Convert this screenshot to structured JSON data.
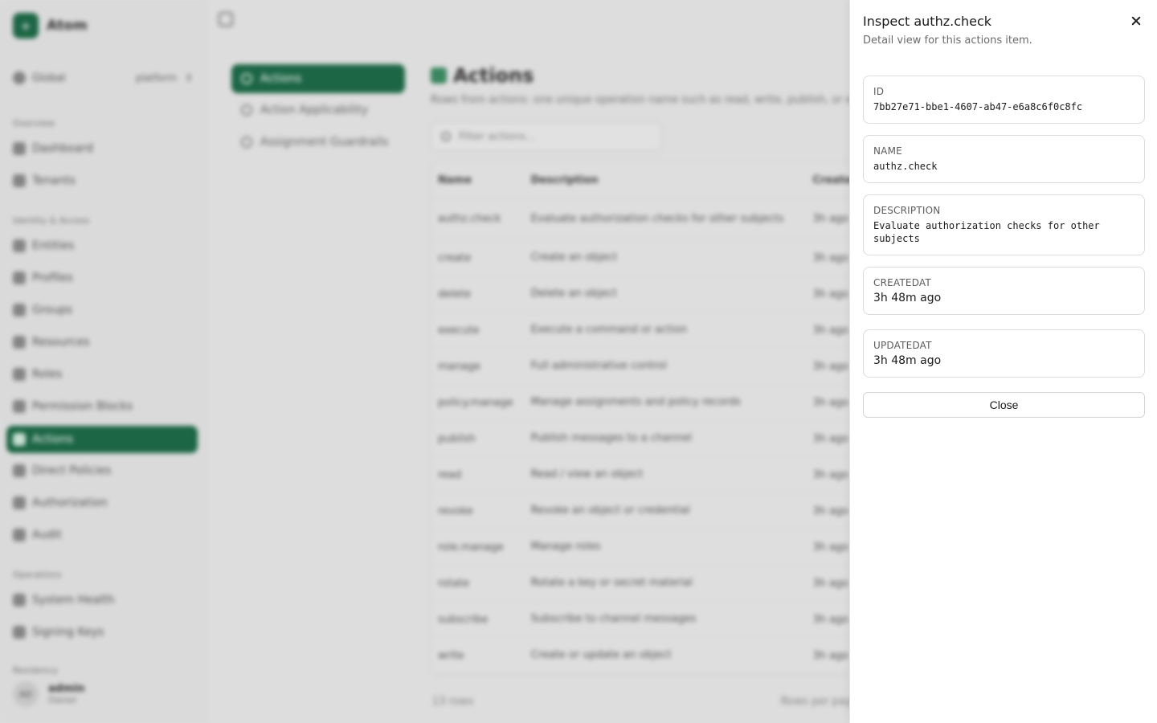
{
  "background": {
    "brand": {
      "logo": "+",
      "name": "Atom"
    },
    "scope": {
      "label": "Global",
      "tag": "platform"
    },
    "sections": {
      "overview": "Overview",
      "identity": "Identity & Access",
      "operations": "Operations",
      "residency": "Residency"
    },
    "nav": {
      "dashboard": "Dashboard",
      "tenants": "Tenants",
      "entities": "Entities",
      "profiles": "Profiles",
      "groups": "Groups",
      "resources": "Resources",
      "roles": "Roles",
      "permission_blocks": "Permission Blocks",
      "actions": "Actions",
      "direct_policies": "Direct Policies",
      "authorization": "Authorization",
      "audit": "Audit",
      "system_health": "System Health",
      "signing_keys": "Signing Keys"
    },
    "user": {
      "initials": "AD",
      "name": "admin",
      "role": "Owner"
    },
    "sub_nav": {
      "actions": "Actions",
      "applicability": "Action Applicability",
      "guardrails": "Assignment Guardrails"
    },
    "page": {
      "title": "Actions",
      "subtitle": "Rows from actions: one unique operation name such as read, write, publish, or execute",
      "filter_placeholder": "Filter actions..."
    },
    "table": {
      "headers": {
        "name": "Name",
        "description": "Description",
        "created": "Created"
      },
      "rows": [
        {
          "name": "authz.check",
          "description": "Evaluate authorization checks for other subjects",
          "created": "3h ago"
        },
        {
          "name": "create",
          "description": "Create an object",
          "created": "3h ago"
        },
        {
          "name": "delete",
          "description": "Delete an object",
          "created": "3h ago"
        },
        {
          "name": "execute",
          "description": "Execute a command or action",
          "created": "3h ago"
        },
        {
          "name": "manage",
          "description": "Full administrative control",
          "created": "3h ago"
        },
        {
          "name": "policy.manage",
          "description": "Manage assignments and policy records",
          "created": "3h ago"
        },
        {
          "name": "publish",
          "description": "Publish messages to a channel",
          "created": "3h ago"
        },
        {
          "name": "read",
          "description": "Read / view an object",
          "created": "3h ago"
        },
        {
          "name": "revoke",
          "description": "Revoke an object or credential",
          "created": "3h ago"
        },
        {
          "name": "role.manage",
          "description": "Manage roles",
          "created": "3h ago"
        },
        {
          "name": "rotate",
          "description": "Rotate a key or secret material",
          "created": "3h ago"
        },
        {
          "name": "subscribe",
          "description": "Subscribe to channel messages",
          "created": "3h ago"
        },
        {
          "name": "write",
          "description": "Create or update an object",
          "created": "3h ago"
        }
      ],
      "row_count": "13 rows",
      "rows_per_page": "Rows per page"
    }
  },
  "drawer": {
    "title": "Inspect authz.check",
    "subtitle": "Detail view for this actions item.",
    "fields": {
      "id": {
        "label": "ID",
        "value": "7bb27e71-bbe1-4607-ab47-e6a8c6f0c8fc"
      },
      "name": {
        "label": "NAME",
        "value": "authz.check"
      },
      "description": {
        "label": "DESCRIPTION",
        "value": "Evaluate authorization checks for other subjects"
      },
      "createdat": {
        "label": "CREATEDAT",
        "value": "3h 48m ago"
      },
      "updatedat": {
        "label": "UPDATEDAT",
        "value": "3h 48m ago"
      }
    },
    "close_label": "Close"
  },
  "colors": {
    "brand": "#1e6b48",
    "drawer_bg": "#ffffff",
    "border": "#dcdcdc"
  },
  "icons": {
    "close": "close-icon"
  }
}
